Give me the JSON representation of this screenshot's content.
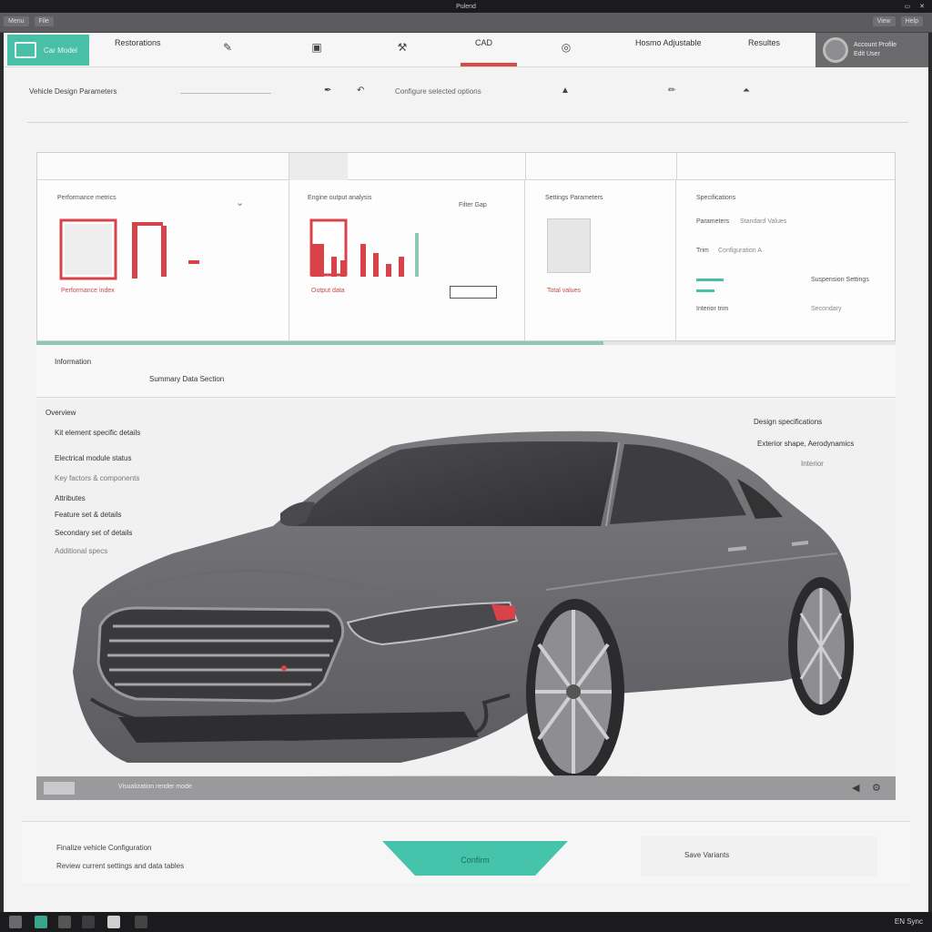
{
  "topbar": {
    "left": [
      "",
      "",
      "",
      ""
    ],
    "title": "Pulend",
    "right": [
      "",
      "",
      "",
      ""
    ]
  },
  "menubar": {
    "left": [
      "Menu",
      "File"
    ],
    "right": [
      "View",
      "Help"
    ]
  },
  "tabs": {
    "home_label": "Car Model",
    "items": [
      "Restorations",
      "Hosmo Adjustable",
      "Resultes"
    ],
    "active_label": "CAD",
    "profile_line1": "Account Profile",
    "profile_line2": "Edit User"
  },
  "toolbar": {
    "label": "Vehicle Design Parameters",
    "subtitle": "Configure selected options"
  },
  "dashboard": {
    "panel1_title": "Performance metrics",
    "panel2_title": "Engine output analysis",
    "panel2_right": "Filter Gap",
    "panel3_title": "Settings Parameters",
    "panel4_title": "Specifications",
    "panel4_rows": [
      "Parameters",
      "Standard Values",
      "Trim",
      "Configuration A",
      "Suspension Settings",
      "Interior trim",
      "Secondary"
    ],
    "caption1": "Performance index",
    "caption2": "Output data",
    "caption3": "Total values"
  },
  "progress": {
    "value": 0.66,
    "color": "#8bc9b4"
  },
  "info": {
    "title": "Information",
    "text": "Summary Data Section"
  },
  "viewer": {
    "left": [
      "Overview",
      "Kit element specific details",
      "Electrical module status",
      "Key factors & components",
      "Attributes",
      "Feature set & details",
      "Secondary set of details",
      "Additional specs"
    ],
    "right": [
      "Design specifications",
      "Exterior shape, Aerodynamics",
      "Interior"
    ],
    "status": "Visualization render mode"
  },
  "bottom": {
    "left1": "Finalize vehicle Configuration",
    "left2": "Review current settings and data tables",
    "confirm": "Confirm",
    "right": "Save Variants"
  },
  "taskbar": {
    "right": "EN  Sync"
  },
  "colors": {
    "accent": "#49bfa8",
    "active": "#d84a45",
    "bar_red": "#d8434a"
  }
}
